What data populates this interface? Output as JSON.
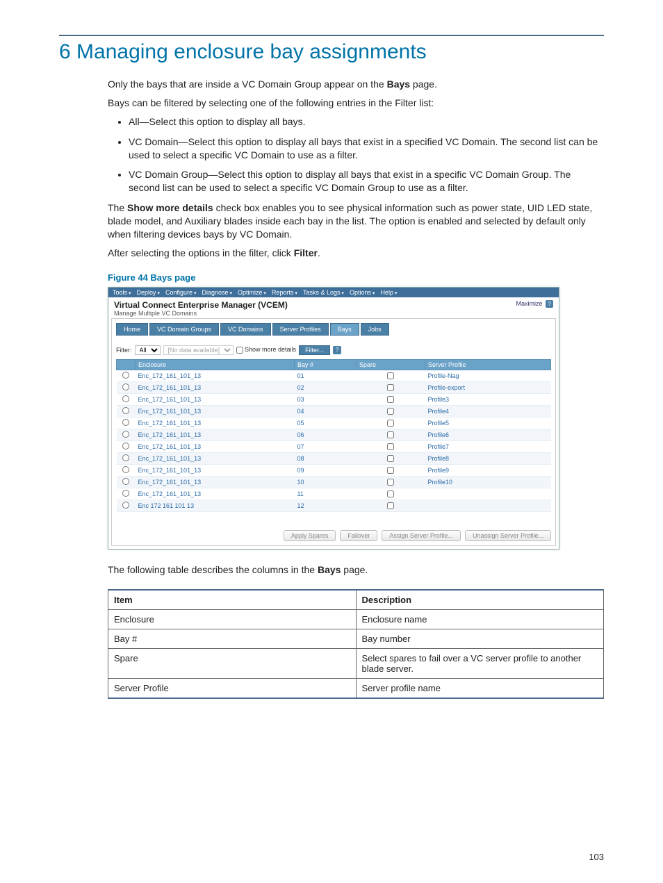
{
  "chapter": {
    "number": "6",
    "title": "Managing enclosure bay assignments"
  },
  "intro": {
    "p1_a": "Only the bays that are inside a VC Domain Group appear on the ",
    "p1_b": "Bays",
    "p1_c": " page.",
    "p2": "Bays can be filtered by selecting one of the following entries in the Filter list:",
    "bullets": [
      "All—Select this option to display all bays.",
      "VC Domain—Select this option to display all bays that exist in a specified VC Domain. The second list can be used to select a specific VC Domain to use as a filter.",
      "VC Domain Group—Select this option to display all bays that exist in a specific VC Domain Group. The second list can be used to select a specific VC Domain Group to use as a filter."
    ],
    "p3_a": "The ",
    "p3_b": "Show more details",
    "p3_c": " check box enables you to see physical information such as power state, UID LED state, blade model, and Auxiliary blades inside each bay in the list. The option is enabled and selected by default only when filtering devices bays by VC Domain.",
    "p4_a": "After selecting the options in the filter, click ",
    "p4_b": "Filter",
    "p4_c": "."
  },
  "figure": {
    "label": "Figure 44 Bays page"
  },
  "shot": {
    "menus": [
      "Tools",
      "Deploy",
      "Configure",
      "Diagnose",
      "Optimize",
      "Reports",
      "Tasks & Logs",
      "Options",
      "Help"
    ],
    "title": "Virtual Connect Enterprise Manager (VCEM)",
    "subtitle": "Manage Multiple VC Domains",
    "maximize": "Maximize",
    "help_q": "?",
    "tabs": [
      "Home",
      "VC Domain Groups",
      "VC Domains",
      "Server Profiles",
      "Bays",
      "Jobs"
    ],
    "active_tab": "Bays",
    "filter": {
      "label": "Filter:",
      "primary": "All",
      "secondary_placeholder": "[No data available]",
      "show_more": "Show more details",
      "button": "Filter...",
      "help": "?"
    },
    "columns": [
      "",
      "Enclosure",
      "Bay #",
      "Spare",
      "Server Profile"
    ],
    "rows": [
      {
        "enc": "Enc_172_161_101_13",
        "bay": "01",
        "profile": "Profile-Nag"
      },
      {
        "enc": "Enc_172_161_101_13",
        "bay": "02",
        "profile": "Profile-export"
      },
      {
        "enc": "Enc_172_161_101_13",
        "bay": "03",
        "profile": "Profile3"
      },
      {
        "enc": "Enc_172_161_101_13",
        "bay": "04",
        "profile": "Profile4"
      },
      {
        "enc": "Enc_172_161_101_13",
        "bay": "05",
        "profile": "Profile5"
      },
      {
        "enc": "Enc_172_161_101_13",
        "bay": "06",
        "profile": "Profile6"
      },
      {
        "enc": "Enc_172_161_101_13",
        "bay": "07",
        "profile": "Profile7"
      },
      {
        "enc": "Enc_172_161_101_13",
        "bay": "08",
        "profile": "Profile8"
      },
      {
        "enc": "Enc_172_161_101_13",
        "bay": "09",
        "profile": "Profile9"
      },
      {
        "enc": "Enc_172_161_101_13",
        "bay": "10",
        "profile": "Profile10"
      },
      {
        "enc": "Enc_172_161_101_13",
        "bay": "11",
        "profile": ""
      },
      {
        "enc": "Enc 172 161 101 13",
        "bay": "12",
        "profile": ""
      }
    ],
    "buttons": [
      "Apply Spares",
      "Failover",
      "Assign Server Profile...",
      "Unassign Server Profile..."
    ]
  },
  "table_intro_a": "The following table describes the columns in the ",
  "table_intro_b": "Bays",
  "table_intro_c": " page.",
  "desc_table": {
    "headers": [
      "Item",
      "Description"
    ],
    "rows": [
      [
        "Enclosure",
        "Enclosure name"
      ],
      [
        "Bay #",
        "Bay number"
      ],
      [
        "Spare",
        "Select spares to fail over a VC server profile to another blade server."
      ],
      [
        "Server Profile",
        "Server profile name"
      ]
    ]
  },
  "page_number": "103"
}
